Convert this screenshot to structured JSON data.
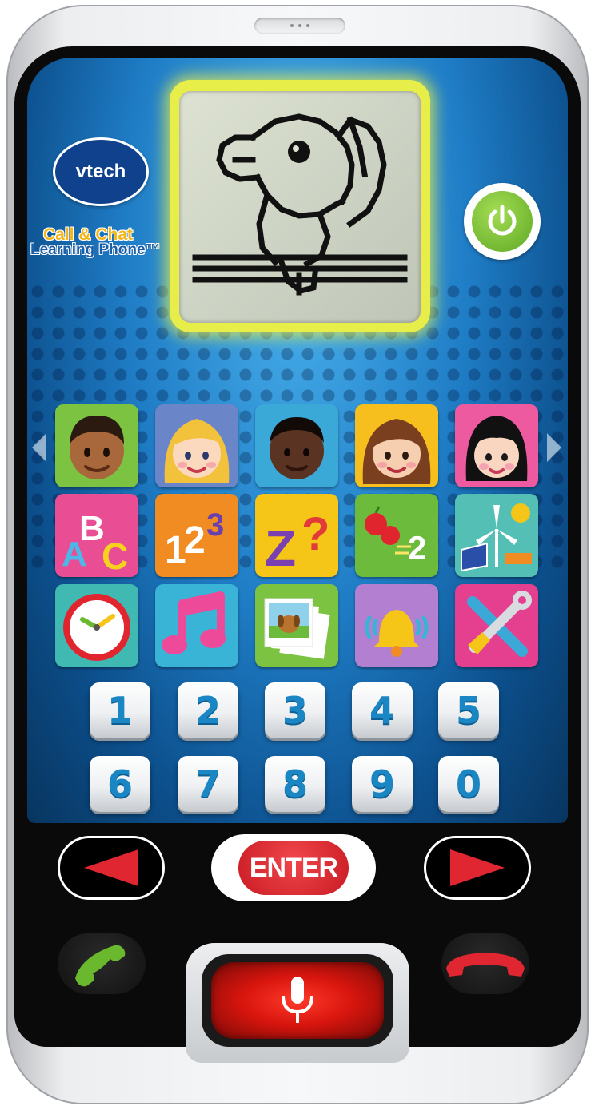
{
  "brand": {
    "logo_text": "vtech"
  },
  "product": {
    "name_line1": "Call & Chat",
    "name_line2": "Learning Phone™"
  },
  "lcd": {
    "character_icon": "parrot-pixel-art-icon"
  },
  "power_button": {
    "icon": "power-icon",
    "color": "#6ab82e"
  },
  "app_tiles": [
    {
      "name": "contact-1",
      "icon": "boy-avatar-icon",
      "bg": "#7cc342"
    },
    {
      "name": "contact-2",
      "icon": "blonde-girl-avatar-icon",
      "bg": "#6a86c9"
    },
    {
      "name": "contact-3",
      "icon": "boy-avatar-icon-dark",
      "bg": "#3aa9d8"
    },
    {
      "name": "contact-4",
      "icon": "girl-avatar-icon",
      "bg": "#f7bf1e"
    },
    {
      "name": "contact-5",
      "icon": "girl-avatar-icon-bob",
      "bg": "#ee5aa0"
    },
    {
      "name": "letters-game",
      "icon": "abc-icon",
      "bg": "#e94d94"
    },
    {
      "name": "numbers-game",
      "icon": "123-icon",
      "bg": "#f18c22"
    },
    {
      "name": "quiz-game",
      "icon": "z-question-icon",
      "bg": "#f5c518"
    },
    {
      "name": "counting-game",
      "icon": "apples-counting-icon",
      "bg": "#6dbb3c"
    },
    {
      "name": "energy-game",
      "icon": "wind-solar-icon",
      "bg": "#54c0b5"
    },
    {
      "name": "clock-app",
      "icon": "clock-icon",
      "bg": "#3fb9b2"
    },
    {
      "name": "music-app",
      "icon": "music-note-icon",
      "bg": "#39b3d6"
    },
    {
      "name": "photos-app",
      "icon": "photos-dog-icon",
      "bg": "#7cc342"
    },
    {
      "name": "ringtone-app",
      "icon": "bell-icon",
      "bg": "#b27fd1"
    },
    {
      "name": "settings-app",
      "icon": "tools-icon",
      "bg": "#e5408f"
    }
  ],
  "abc_tile": {
    "a": "A",
    "b": "B",
    "c": "C"
  },
  "num_tile": {
    "one": "1",
    "two": "2",
    "three": "3"
  },
  "quiz_tile": {
    "z": "Z",
    "q": "?"
  },
  "count_tile": {
    "two": "2"
  },
  "keypad": [
    "1",
    "2",
    "3",
    "4",
    "5",
    "6",
    "7",
    "8",
    "9",
    "0"
  ],
  "controls": {
    "enter_label": "ENTER",
    "left_icon": "left-arrow-icon",
    "right_icon": "right-arrow-icon",
    "call_icon": "phone-call-icon",
    "hangup_icon": "phone-hangup-icon",
    "mic_icon": "microphone-icon",
    "accent_red": "#e02630",
    "accent_green": "#6ab82e"
  }
}
